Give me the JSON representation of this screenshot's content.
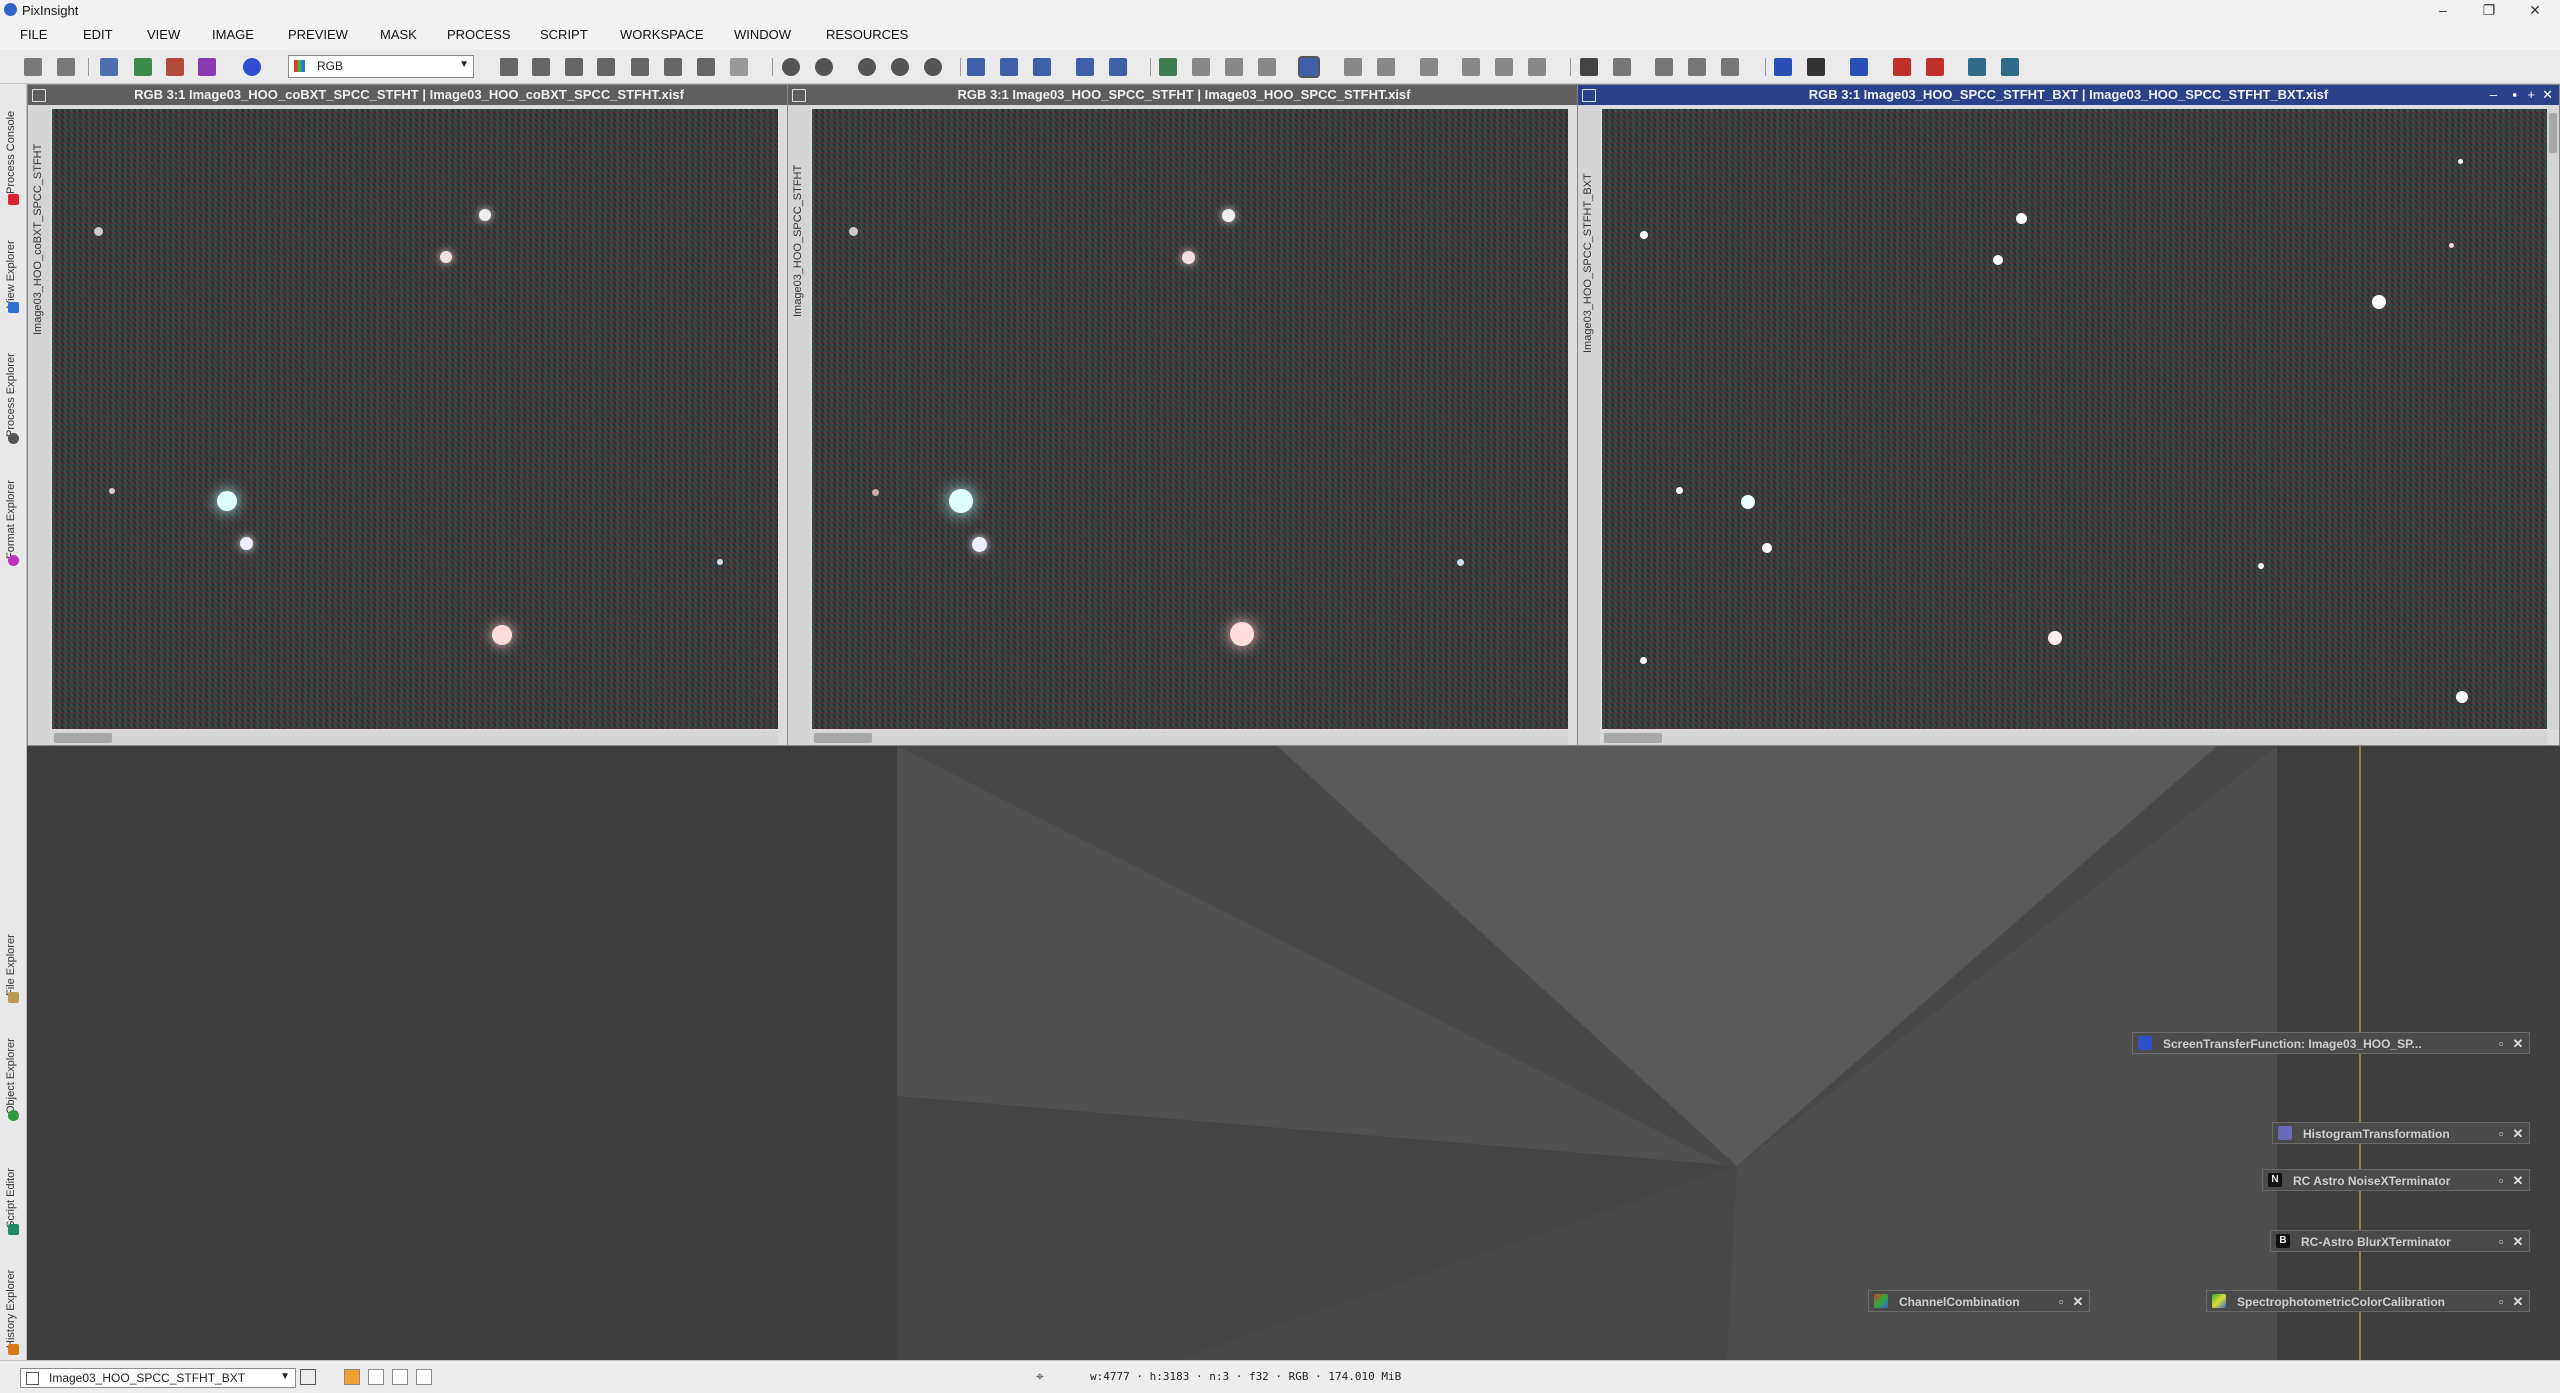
{
  "app": {
    "title": "PixInsight"
  },
  "menu": [
    "FILE",
    "EDIT",
    "VIEW",
    "IMAGE",
    "PREVIEW",
    "MASK",
    "PROCESS",
    "SCRIPT",
    "WORKSPACE",
    "WINDOW",
    "RESOURCES"
  ],
  "toolbar": {
    "channel_select": "RGB"
  },
  "left_dock_tabs": [
    "Process Console",
    "View Explorer",
    "Process Explorer",
    "Format Explorer",
    "File Explorer",
    "Object Explorer",
    "Script Editor",
    "History Explorer"
  ],
  "image_windows": [
    {
      "title": "RGB 3:1 Image03_HOO_coBXT_SPCC_STFHT | Image03_HOO_coBXT_SPCC_STFHT.xisf",
      "side_label": "Image03_HOO_coBXT_SPCC_STFHT",
      "active": false
    },
    {
      "title": "RGB 3:1 Image03_HOO_SPCC_STFHT | Image03_HOO_SPCC_STFHT.xisf",
      "side_label": "Image03_HOO_SPCC_STFHT",
      "active": false
    },
    {
      "title": "RGB 3:1 Image03_HOO_SPCC_STFHT_BXT | Image03_HOO_SPCC_STFHT_BXT.xisf",
      "side_label": "Image03_HOO_SPCC_STFHT_BXT",
      "active": true
    }
  ],
  "process_icons": [
    {
      "label": "ScreenTransferFunction: Image03_HOO_SP...",
      "badge": ""
    },
    {
      "label": "HistogramTransformation",
      "badge": ""
    },
    {
      "label": "RC Astro NoiseXTerminator",
      "badge": "N"
    },
    {
      "label": "RC-Astro BlurXTerminator",
      "badge": "B"
    },
    {
      "label": "ChannelCombination",
      "badge": ""
    },
    {
      "label": "SpectrophotometricColorCalibration",
      "badge": ""
    }
  ],
  "status": {
    "view_select": "Image03_HOO_SPCC_STFHT_BXT",
    "info": "w:4777 · h:3183 · n:3 · f32 · RGB · 174.010 MiB"
  },
  "colors": {
    "active_title": "#29428a",
    "inactive_title": "#5e5e5e",
    "workspace": "#3e3e3e"
  }
}
